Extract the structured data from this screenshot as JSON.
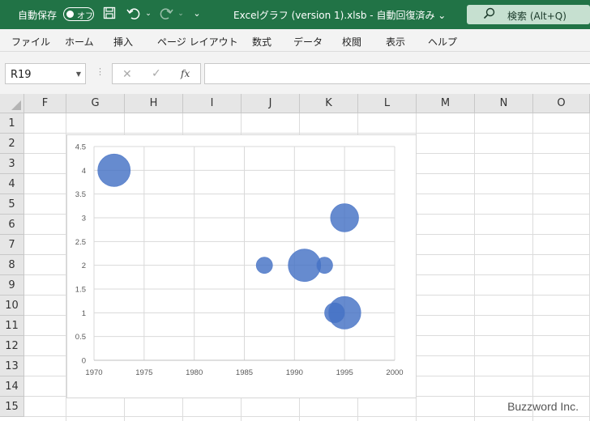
{
  "titlebar": {
    "autosave_label": "自動保存",
    "toggle_text": "オフ",
    "title": "Excelグラフ (version 1).xlsb  -  自動回復済み ⌄",
    "search_text": "検索 (Alt+Q)"
  },
  "menu": {
    "items": [
      "ファイル",
      "ホーム",
      "挿入",
      "ページ レイアウト",
      "数式",
      "データ",
      "校閲",
      "表示",
      "ヘルプ"
    ]
  },
  "formula_bar": {
    "name_box": "R19",
    "fx": "fx",
    "value": ""
  },
  "sheet": {
    "columns": [
      "F",
      "G",
      "H",
      "I",
      "J",
      "K",
      "L",
      "M",
      "N",
      "O"
    ],
    "rows": [
      "1",
      "2",
      "3",
      "4",
      "5",
      "6",
      "7",
      "8",
      "9",
      "10",
      "11",
      "12",
      "13",
      "14",
      "15"
    ]
  },
  "chart_data": {
    "type": "scatter",
    "variant": "bubble",
    "title": "",
    "xlabel": "",
    "ylabel": "",
    "xlim": [
      1970,
      2000
    ],
    "ylim": [
      0,
      4.5
    ],
    "x_ticks": [
      "1970",
      "1975",
      "1980",
      "1985",
      "1990",
      "1995",
      "2000"
    ],
    "y_ticks": [
      "0",
      "0.5",
      "1",
      "1.5",
      "2",
      "2.5",
      "3",
      "3.5",
      "4",
      "4.5"
    ],
    "grid": true,
    "legend": "none",
    "color": "#4472C4",
    "series": [
      {
        "points": [
          {
            "x": 1972,
            "y": 4,
            "size": 4
          },
          {
            "x": 1987,
            "y": 2,
            "size": 1
          },
          {
            "x": 1991,
            "y": 2,
            "size": 4
          },
          {
            "x": 1993,
            "y": 2,
            "size": 1
          },
          {
            "x": 1995,
            "y": 3,
            "size": 3
          },
          {
            "x": 1994,
            "y": 1,
            "size": 1.5
          },
          {
            "x": 1995,
            "y": 1,
            "size": 4
          }
        ]
      }
    ]
  },
  "watermark": "Buzzword Inc."
}
